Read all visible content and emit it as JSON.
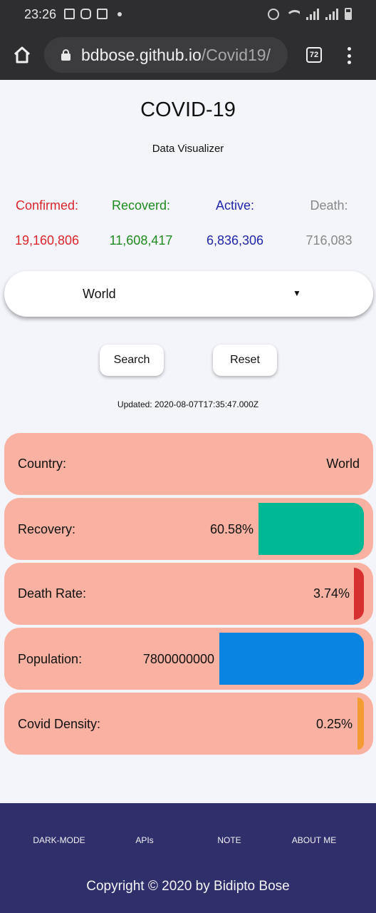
{
  "status_bar": {
    "time": "23:26",
    "left_icons": [
      "image-icon",
      "instagram-icon",
      "gmail-icon",
      "dot-icon"
    ],
    "right_icons": [
      "alarm-icon",
      "wifi-icon",
      "signal-icon",
      "signal-icon",
      "battery-icon"
    ]
  },
  "browser": {
    "url_host": "bdbose.github.io",
    "url_path": "/Covid19/",
    "tab_count": "72"
  },
  "header": {
    "title": "COVID-19",
    "subtitle": "Data Visualizer"
  },
  "stats": {
    "confirmed": {
      "label": "Confirmed:",
      "value": "19,160,806",
      "color": "#d9262c"
    },
    "recovered": {
      "label": "Recoverd:",
      "value": "11,608,417",
      "color": "#1f8a1f"
    },
    "active": {
      "label": "Active:",
      "value": "6,836,306",
      "color": "#1f27a8"
    },
    "death": {
      "label": "Death:",
      "value": "716,083",
      "color": "#888888"
    }
  },
  "select": {
    "value": "World",
    "arrow": "▼"
  },
  "buttons": {
    "search": "Search",
    "reset": "Reset"
  },
  "updated": "Updated: 2020-08-07T17:35:47.000Z",
  "cards": {
    "country": {
      "label": "Country:",
      "value": "World"
    },
    "recovery": {
      "label": "Recovery:",
      "value": "60.58%",
      "bar_color": "#00b894"
    },
    "death_rate": {
      "label": "Death Rate:",
      "value": "3.74%",
      "bar_color": "#d63031"
    },
    "population": {
      "label": "Population:",
      "value": "7800000000",
      "bar_color": "#0984e3"
    },
    "covid_density": {
      "label": "Covid Density:",
      "value": "0.25%",
      "bar_color": "#f39c33"
    }
  },
  "footer": {
    "links": [
      "DARK-MODE",
      "APIs",
      "NOTE",
      "ABOUT ME"
    ],
    "copyright": "Copyright © 2020 by Bidipto Bose"
  },
  "colors": {
    "card_bg": "#f9b2a1",
    "footer_bg": "#2e2f6b",
    "chrome_bg": "#2e2e30"
  }
}
